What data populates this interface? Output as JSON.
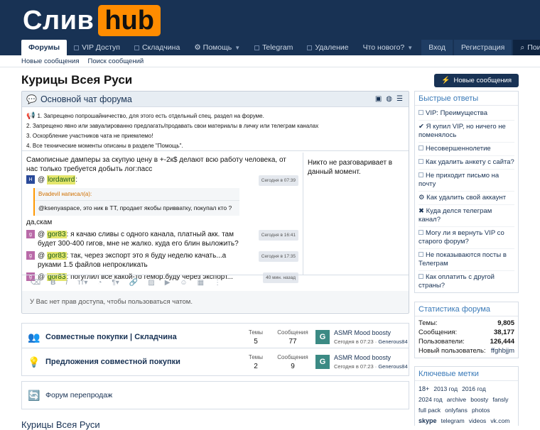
{
  "header": {
    "logo_text": "Слив",
    "logo_hub": "hub",
    "nav": [
      {
        "label": "Форумы",
        "active": true
      },
      {
        "label": "VIP Доступ"
      },
      {
        "label": "Складчина"
      },
      {
        "label": "⚙ Помощь"
      },
      {
        "label": "Telegram"
      },
      {
        "label": "Удаление"
      },
      {
        "label": "Что нового?"
      }
    ],
    "login": "Вход",
    "register": "Регистрация",
    "search": "Поиск",
    "subnav": [
      "Новые сообщения",
      "Поиск сообщений"
    ]
  },
  "page": {
    "title": "Курицы Всея Руси",
    "new_messages_btn": "Новые сообщения"
  },
  "chat": {
    "title": "Основной чат форума",
    "rules": [
      "1. Запрещено попрошайничество, для этого есть отдельный спец. раздел на форуме.",
      "2. Запрещено явно или завуалированно предлагать/продавать свои материалы в личку или телеграм каналах",
      "3. Оскорбление участников чата не приемлемо!",
      "4. Все технические моменты описаны в разделе \"Помощь\"."
    ],
    "msg1_text": "Самописные дамперы за скупую цену в +-2к$ делают всю работу человека, от нас только требуется добыть лог:пасс",
    "msg2": {
      "avatar": "H",
      "nick": "lordawrd",
      "time": "Сегодня в 07:39"
    },
    "quote_head": "Bvadevil написал(а):",
    "quote_body": "@ksenyaspace, это ник в ТТ, продает якобы привватку, покупал кто ?",
    "msg3_text": "да,скам",
    "msg4": {
      "avatar": "g",
      "nick": "gor83",
      "text": ": я качаю сливы с одного канала, платный акк. там будет 300-400 гигов, мне не жалко. куда его блин выложить?",
      "time": "Сегодня в 16:41"
    },
    "msg5": {
      "avatar": "g",
      "nick": "gor83",
      "text": ": так, через экспорт это я буду неделю качать...а руками 1.5 файлов непрокликать",
      "time": "Сегодня в 17:35"
    },
    "msg6": {
      "avatar": "g",
      "nick": "gor83",
      "text": ": погуглил все какой-то гемор.буду через экспорт...",
      "time": "40 мин. назад"
    },
    "side_text": "Никто не разговаривает в данный момент.",
    "no_access": "У Вас нет прав доступа, чтобы пользоваться чатом."
  },
  "forums": [
    {
      "title": "Совместные покупки | Складчина",
      "threads_label": "Темы",
      "threads": "5",
      "posts_label": "Сообщения",
      "posts": "77",
      "last_title": "ASMR Mood boosty",
      "last_time": "Сегодня в 07:23",
      "last_user": "Generous84",
      "avatar": "G"
    },
    {
      "title": "Предложения совместной покупки",
      "threads_label": "Темы",
      "threads": "2",
      "posts_label": "Сообщения",
      "posts": "9",
      "last_title": "ASMR Mood boosty",
      "last_time": "Сегодня в 07:23",
      "last_user": "Generous84",
      "avatar": "G"
    },
    {
      "title": "Форум перепродаж"
    }
  ],
  "category2": "Курицы Всея Руси",
  "sidebar": {
    "quick_title": "Быстрые ответы",
    "quick_items": [
      "VIP: Преимущества",
      "✔ Я купил VIP, но ничего не поменялось",
      "Несовершеннолетие",
      "Как удалить анкету с сайта?",
      "Не приходит письмо на почту",
      "⚙ Как удалить свой аккаунт",
      "✖ Куда делся телеграм канал?",
      "Могу ли я вернуть VIP со старого форум?",
      "Не показываются посты в Телеграм",
      "Как оплатить с другой страны?"
    ],
    "stats_title": "Статистика форума",
    "stats": [
      {
        "label": "Темы:",
        "value": "9,805"
      },
      {
        "label": "Сообщения:",
        "value": "38,177"
      },
      {
        "label": "Пользователи:",
        "value": "126,444"
      },
      {
        "label": "Новый пользователь:",
        "value": "ffghbjjm"
      }
    ],
    "tags_title": "Ключевые метки",
    "tags": [
      "18+",
      "2013 год",
      "2016 год",
      "2024 год",
      "archive",
      "boosty",
      "fansly",
      "full pack",
      "onlyfans",
      "photos",
      "skype",
      "telegram",
      "videos",
      "vk.com"
    ]
  },
  "colors": {
    "header": "#183254",
    "accent": "#ff8c00",
    "link": "#183254"
  }
}
